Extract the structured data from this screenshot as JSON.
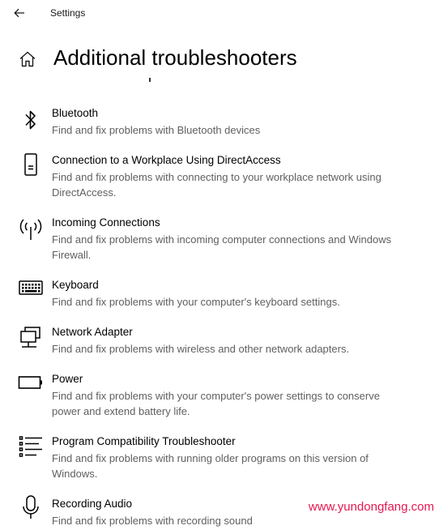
{
  "window": {
    "app_title": "Settings",
    "back_icon": "arrow-left-icon"
  },
  "header": {
    "home_icon": "home-icon",
    "title": "Additional troubleshooters"
  },
  "items": [
    {
      "icon": "bluetooth-icon",
      "title": "Bluetooth",
      "description": "Find and fix problems with Bluetooth devices"
    },
    {
      "icon": "phone-device-icon",
      "title": "Connection to a Workplace Using DirectAccess",
      "description": "Find and fix problems with connecting to your workplace network using DirectAccess."
    },
    {
      "icon": "antenna-signal-icon",
      "title": "Incoming Connections",
      "description": "Find and fix problems with incoming computer connections and Windows Firewall."
    },
    {
      "icon": "keyboard-icon",
      "title": "Keyboard",
      "description": "Find and fix problems with your computer's keyboard settings."
    },
    {
      "icon": "network-monitor-icon",
      "title": "Network Adapter",
      "description": "Find and fix problems with wireless and other network adapters."
    },
    {
      "icon": "battery-icon",
      "title": "Power",
      "description": "Find and fix problems with your computer's power settings to conserve power and extend battery life."
    },
    {
      "icon": "checklist-icon",
      "title": "Program Compatibility Troubleshooter",
      "description": "Find and fix problems with running older programs on this version of Windows."
    },
    {
      "icon": "microphone-icon",
      "title": "Recording Audio",
      "description": "Find and fix problems with recording sound"
    }
  ],
  "watermark": "www.yundongfang.com",
  "colors": {
    "text_primary": "#000000",
    "text_secondary": "#5f5f5f",
    "watermark": "#e8174f"
  }
}
